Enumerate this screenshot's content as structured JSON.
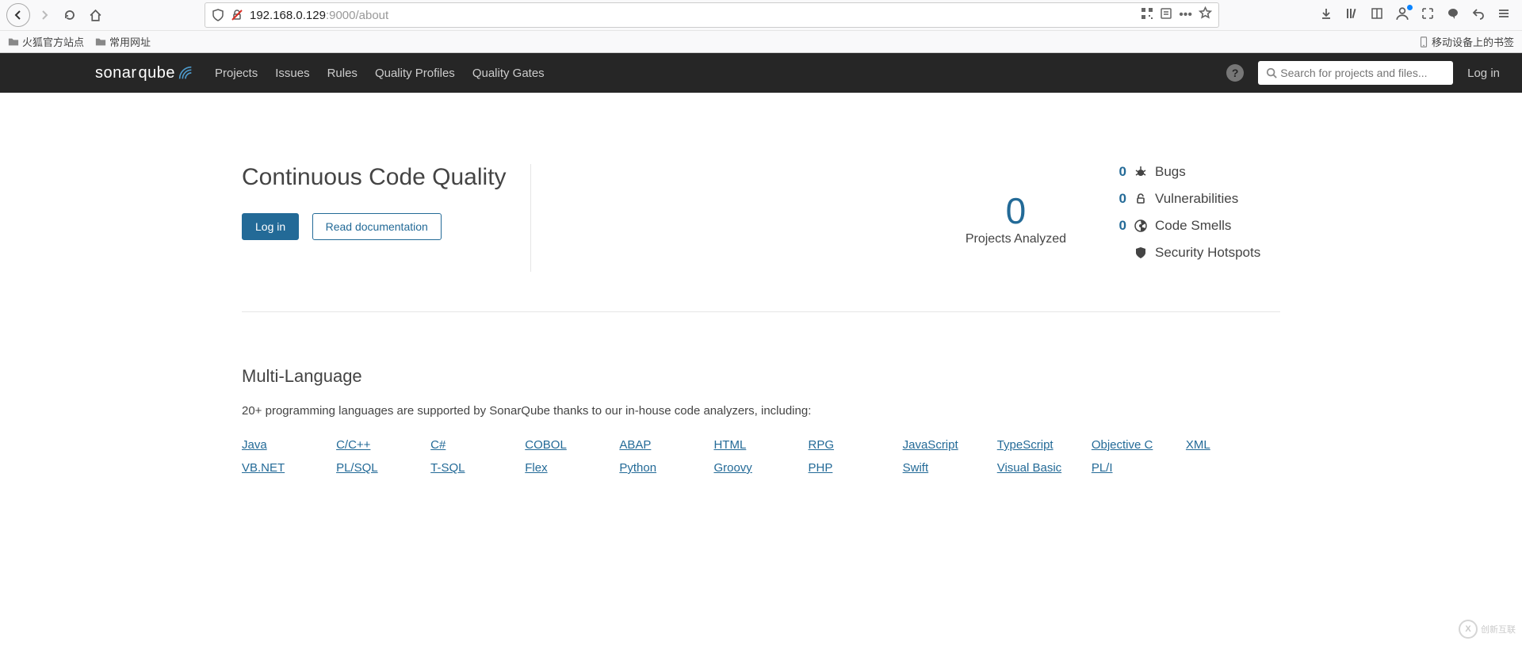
{
  "browser": {
    "url_prefix": "192.168.0.129",
    "url_suffix": ":9000/about",
    "bookmarks": {
      "firefox_official": "火狐官方站点",
      "common": "常用网址",
      "mobile_bookmarks": "移动设备上的书签"
    }
  },
  "header": {
    "logo1": "sonar",
    "logo2": "qube",
    "nav": {
      "projects": "Projects",
      "issues": "Issues",
      "rules": "Rules",
      "quality_profiles": "Quality Profiles",
      "quality_gates": "Quality Gates"
    },
    "search_placeholder": "Search for projects and files...",
    "login": "Log in"
  },
  "hero": {
    "title": "Continuous Code Quality",
    "login_btn": "Log in",
    "docs_btn": "Read documentation",
    "projects_count": "0",
    "projects_label": "Projects Analyzed",
    "stats": {
      "bugs_n": "0",
      "bugs": "Bugs",
      "vuln_n": "0",
      "vuln": "Vulnerabilities",
      "smells_n": "0",
      "smells": "Code Smells",
      "hotspots": "Security Hotspots"
    }
  },
  "ml": {
    "title": "Multi-Language",
    "desc": "20+ programming languages are supported by SonarQube thanks to our in-house code analyzers, including:",
    "langs": [
      "Java",
      "C/C++",
      "C#",
      "COBOL",
      "ABAP",
      "HTML",
      "RPG",
      "JavaScript",
      "TypeScript",
      "Objective C",
      "XML",
      "VB.NET",
      "PL/SQL",
      "T-SQL",
      "Flex",
      "Python",
      "Groovy",
      "PHP",
      "Swift",
      "Visual Basic",
      "PL/I"
    ]
  },
  "watermark": "创新互联"
}
